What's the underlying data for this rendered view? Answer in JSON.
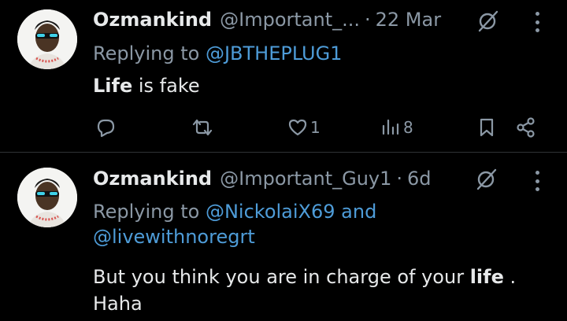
{
  "tweets": [
    {
      "author_name": "Ozmankind",
      "author_handle": "@Important_...",
      "separator": "·",
      "timestamp": "22 Mar",
      "replying_prefix": "Replying to",
      "replying_to": [
        "@JBTHEPLUG1"
      ],
      "replying_joiner": "",
      "body_highlight": "Life",
      "body_rest": " is fake",
      "reply_count": "",
      "retweet_count": "",
      "like_count": "1",
      "view_count": "8"
    },
    {
      "author_name": "Ozmankind",
      "author_handle": "@Important_Guy1",
      "separator": "·",
      "timestamp": "6d",
      "replying_prefix": "Replying to",
      "replying_to": [
        "@NickolaiX69",
        "@livewithnoregrt"
      ],
      "replying_joiner": "and",
      "body_before": "But you think you are in charge of your ",
      "body_highlight": "life",
      "body_after": " .",
      "body_line2": "Haha"
    }
  ],
  "colors": {
    "background": "#000000",
    "text": "#e7e9ea",
    "muted": "#8b98a5",
    "link": "#4e9cd8",
    "divider": "#2f3336"
  },
  "icons": [
    "grok-icon",
    "more-icon",
    "reply-icon",
    "retweet-icon",
    "like-icon",
    "views-icon",
    "bookmark-icon",
    "share-icon"
  ]
}
